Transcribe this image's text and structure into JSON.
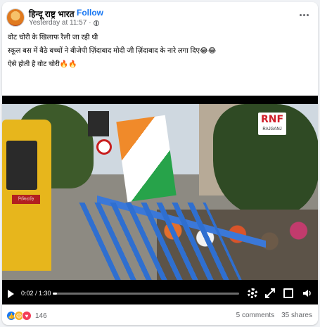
{
  "header": {
    "page_name": "हिन्दू राष्ट्र भारत",
    "separator": "·",
    "follow_label": "Follow",
    "timestamp": "Yesterday at 11:57",
    "timestamp_sep": "·"
  },
  "post": {
    "line1": "वोट चोरी के खिलाफ रैली जा रही थी",
    "line2": "स्कूल बस में बैठे बच्चों ने बीजेपी ज़िंदाबाद मोदी जी ज़िंदाबाद के नारे लगा दिए😂😂",
    "line3": "ऐसे होती है वोट चोरी🔥🔥"
  },
  "video": {
    "logo_text": "RNF",
    "logo_sub": "RAJGANJ",
    "bus_sign": "শিলিগুড়ি",
    "time_label": "0:02 / 1:30",
    "progress_fraction": 0.022
  },
  "footer": {
    "reaction_count": "146",
    "comments": "5 comments",
    "shares": "35 shares"
  },
  "icons": {
    "like": "like-icon",
    "haha": "haha-icon",
    "love": "love-icon",
    "play": "play-icon",
    "settings": "gear-icon",
    "expand": "expand-icon",
    "fullscreen": "fullscreen-icon",
    "volume": "volume-icon",
    "more": "more-options-icon",
    "globe": "globe-icon"
  },
  "colors": {
    "accent": "#1877f2",
    "like": "#1877f2",
    "haha": "#f7b125",
    "love": "#f33e58"
  }
}
